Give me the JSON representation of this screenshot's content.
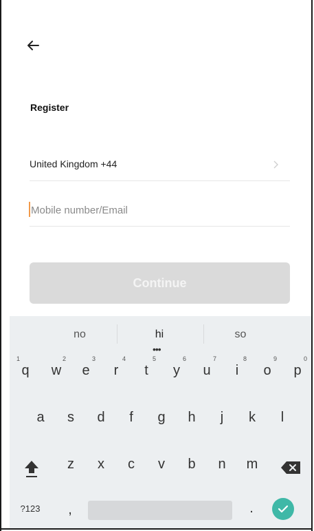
{
  "header": {
    "back_icon": "arrow-left-icon"
  },
  "form": {
    "title": "Register",
    "country_label": "United Kingdom +44",
    "country_chevron_icon": "chevron-right-icon",
    "input_placeholder": "Mobile number/Email",
    "input_value": "",
    "continue_label": "Continue"
  },
  "keyboard": {
    "suggestions": [
      "no",
      "hi",
      "so"
    ],
    "row1": [
      "q",
      "w",
      "e",
      "r",
      "t",
      "y",
      "u",
      "i",
      "o",
      "p"
    ],
    "row1_hints": [
      "1",
      "2",
      "3",
      "4",
      "5",
      "6",
      "7",
      "8",
      "9",
      "0"
    ],
    "row2": [
      "a",
      "s",
      "d",
      "f",
      "g",
      "h",
      "j",
      "k",
      "l"
    ],
    "row3": [
      "z",
      "x",
      "c",
      "v",
      "b",
      "n",
      "m"
    ],
    "shift_icon": "shift-arrow-icon",
    "backspace_icon": "backspace-icon",
    "symbols_label": "?123",
    "comma_label": ",",
    "period_label": ".",
    "enter_icon": "checkmark-icon"
  },
  "colors": {
    "button_disabled": "#dadada",
    "enter_key": "#3fb8a7",
    "caret": "#f29a4a"
  }
}
